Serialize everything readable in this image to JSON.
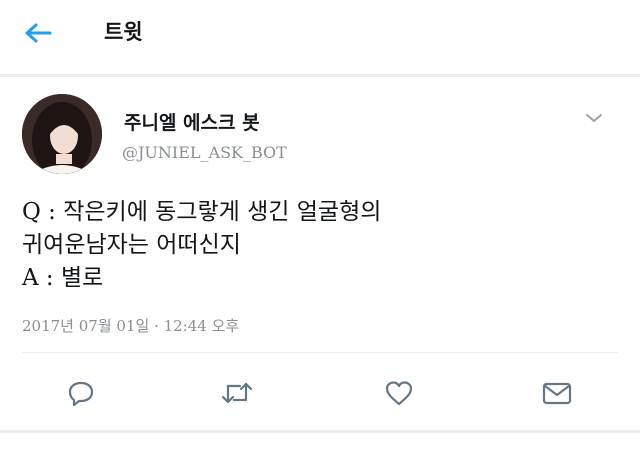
{
  "header": {
    "title": "트윗",
    "back_icon": "arrow-left-icon"
  },
  "tweet": {
    "author_name": "주니엘 에스크 봇",
    "author_handle": "@JUNIEL_ASK_BOT",
    "text_lines": [
      "Q : 작은키에 동그랗게 생긴 얼굴형의",
      "귀여운남자는 어떠신지",
      "A : 별로"
    ],
    "timestamp": "2017년 07월 01일 · 12:44 오후"
  },
  "actions": [
    {
      "name": "reply",
      "icon": "reply-icon"
    },
    {
      "name": "retweet",
      "icon": "retweet-icon"
    },
    {
      "name": "like",
      "icon": "heart-icon"
    },
    {
      "name": "share",
      "icon": "envelope-icon"
    }
  ],
  "colors": {
    "accent": "#1da1f2",
    "icon_gray": "#657786",
    "muted_text": "#8a8f94",
    "divider": "#e6ecf0"
  }
}
